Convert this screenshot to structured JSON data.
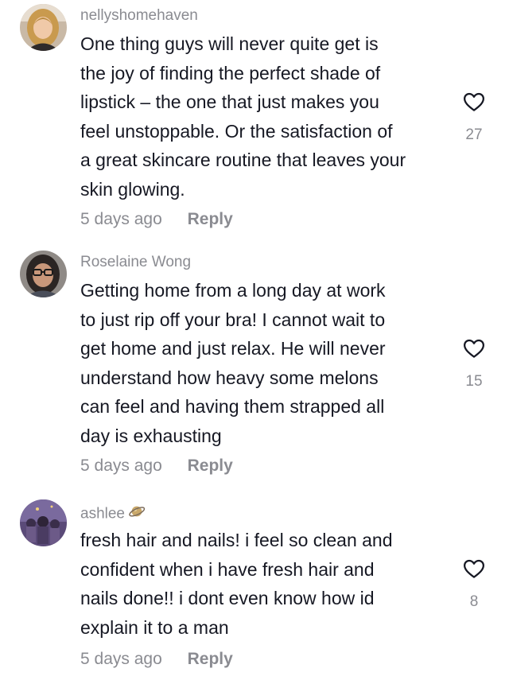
{
  "comments": [
    {
      "username": "nellyshomehaven",
      "lines": [
        "One thing guys will never quite get is",
        "the joy of finding the perfect shade of",
        "lipstick – the one that just makes you",
        "feel unstoppable. Or the satisfaction of",
        "a great skincare routine that leaves your",
        "skin glowing."
      ],
      "time": "5 days ago",
      "reply_label": "Reply",
      "likes": "27"
    },
    {
      "username": "Roselaine Wong",
      "lines": [
        "Getting home from a long day at work",
        "to just rip off your bra! I cannot wait to",
        "get home and just relax. He will never",
        "understand how heavy some melons",
        "can feel and having them strapped all",
        "day is exhausting"
      ],
      "time": "5 days ago",
      "reply_label": "Reply",
      "likes": "15"
    },
    {
      "username": "ashlee",
      "username_emoji": "ringed-planet-icon",
      "lines": [
        "fresh hair and nails! i feel so clean and",
        "confident when i have fresh hair and",
        "nails done!! i dont even know how id",
        "explain it to a man"
      ],
      "time": "5 days ago",
      "reply_label": "Reply",
      "likes": "8"
    }
  ],
  "icons": {
    "like": "heart-outline-icon"
  },
  "colors": {
    "text": "#161823",
    "muted": "#8a8b91",
    "background": "#ffffff"
  }
}
